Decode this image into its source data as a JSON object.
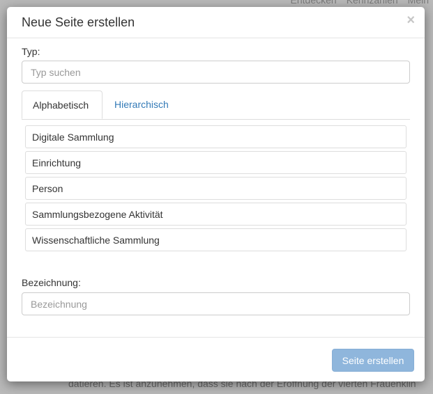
{
  "background": {
    "nav": [
      "Entdecken",
      "Kennzahlen",
      "Mein"
    ],
    "footer_text": "datieren. Es ist anzunehmen, dass sie nach der Eröffnung der vierten Frauenklin"
  },
  "modal": {
    "title": "Neue Seite erstellen",
    "close_icon": "×",
    "type_label": "Typ:",
    "type_placeholder": "Typ suchen",
    "tabs": [
      {
        "label": "Alphabetisch",
        "active": true
      },
      {
        "label": "Hierarchisch",
        "active": false
      }
    ],
    "types": [
      "Digitale Sammlung",
      "Einrichtung",
      "Person",
      "Sammlungsbezogene Aktivität",
      "Wissenschaftliche Sammlung"
    ],
    "name_label": "Bezeichnung:",
    "name_placeholder": "Bezeichnung",
    "submit_label": "Seite erstellen"
  },
  "colors": {
    "link": "#337ab7",
    "primary_disabled": "#8fb6dc"
  }
}
